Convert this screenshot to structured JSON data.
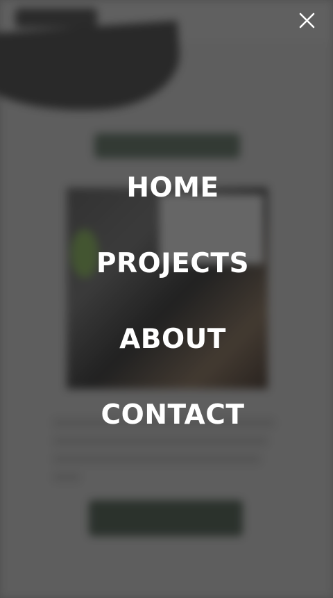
{
  "menu": {
    "items": [
      {
        "label": "HOME"
      },
      {
        "label": "PROJECTS"
      },
      {
        "label": "ABOUT"
      },
      {
        "label": "CONTACT"
      }
    ]
  },
  "icons": {
    "close": "close-icon"
  },
  "colors": {
    "overlay_text": "#ffffff",
    "background_accent": "#2f3b31"
  }
}
